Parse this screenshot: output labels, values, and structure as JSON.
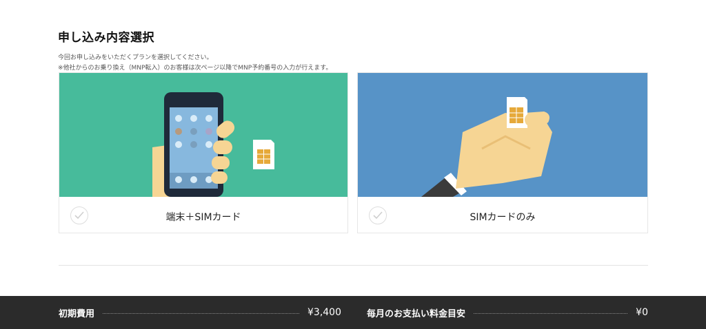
{
  "page": {
    "title": "申し込み内容選択",
    "description_line1": "今回お申し込みをいただくプランを選択してください。",
    "description_line2": "※他社からのお乗り換え（MNP転入）のお客様は次ページ以降でMNP予約番号の入力が行えます。"
  },
  "plans": [
    {
      "label": "端末＋SIMカード",
      "illustration": "phone-in-hand-with-sim-card",
      "bg_color": "#47bb9b",
      "selected": false
    },
    {
      "label": "SIMカードのみ",
      "illustration": "hand-holding-sim-card",
      "bg_color": "#5793c7",
      "selected": false
    }
  ],
  "footer": {
    "initial_cost_label": "初期費用",
    "initial_cost_value": "¥3,400",
    "monthly_label": "毎月のお支払い料金目安",
    "monthly_value": "¥0"
  },
  "colors": {
    "footer_bg": "#2b2b2b",
    "card_green": "#47bb9b",
    "card_blue": "#5793c7",
    "skin": "#f6d594",
    "sim_gold": "#e6a93a"
  }
}
